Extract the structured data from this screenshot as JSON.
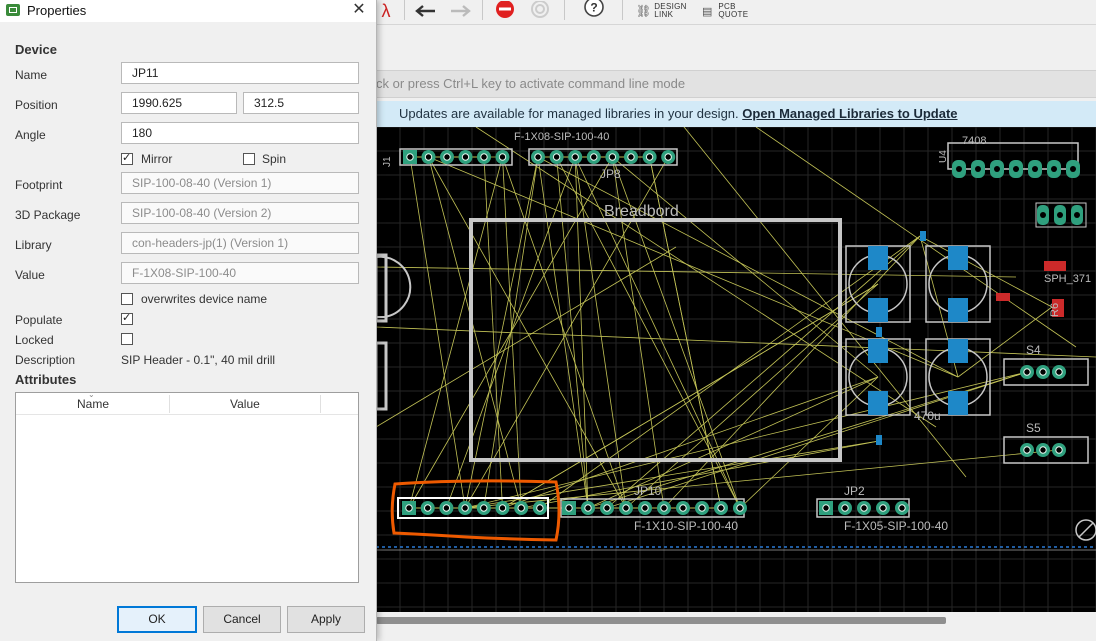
{
  "dialog": {
    "title": "Properties",
    "section_device": "Device",
    "name_label": "Name",
    "name_value": "JP11",
    "position_label": "Position",
    "position_x": "1990.625",
    "position_y": "312.5",
    "angle_label": "Angle",
    "angle_value": "180",
    "mirror_label": "Mirror",
    "mirror_checked": true,
    "spin_label": "Spin",
    "spin_checked": false,
    "footprint_label": "Footprint",
    "footprint_value": "SIP-100-08-40 (Version 1)",
    "package3d_label": "3D Package",
    "package3d_value": "SIP-100-08-40 (Version 2)",
    "library_label": "Library",
    "library_value": "con-headers-jp(1) (Version 1)",
    "value_label": "Value",
    "value_value": "F-1X08-SIP-100-40",
    "overwrites_label": "overwrites device name",
    "overwrites_checked": false,
    "populate_label": "Populate",
    "populate_checked": true,
    "locked_label": "Locked",
    "locked_checked": false,
    "description_label": "Description",
    "description_value": "SIP Header - 0.1\", 40 mil drill",
    "section_attributes": "Attributes",
    "attr_col_name": "Name",
    "attr_col_value": "Value",
    "ok_label": "OK",
    "cancel_label": "Cancel",
    "apply_label": "Apply"
  },
  "toolbar": {
    "design_link_label_1": "DESIGN",
    "design_link_label_2": "LINK",
    "pcb_quote_label_1": "PCB",
    "pcb_quote_label_2": "QUOTE",
    "icons": [
      "function-icon",
      "undo-icon",
      "redo-icon",
      "stop-icon",
      "disabled-icon",
      "help-icon",
      "design-link-icon",
      "pcb-quote-icon"
    ]
  },
  "command_line": {
    "placeholder": "ck or press Ctrl+L key to activate command line mode"
  },
  "banner": {
    "text": "Updates are available for managed libraries in your design.",
    "link": "Open Managed Libraries to Update",
    "bg_color": "#d3eaf7"
  },
  "board": {
    "breadboard_label": "Breadbord",
    "labels": {
      "j1": "J1",
      "f1x08_top": "F-1X08-SIP-100-40",
      "jp8": "JP8",
      "u4": "U4",
      "n7408": "7408",
      "jp10": "JP10",
      "f1x10": "F-1X10-SIP-100-40",
      "jp2": "JP2",
      "f1x05": "F-1X05-SIP-100-40",
      "s4": "S4",
      "s5": "S5",
      "c470": "470u",
      "r6": "R6",
      "smd": "SPH_371"
    },
    "colors": {
      "pad": "#2fa07e",
      "trace": "#d8d860",
      "outline": "#c7c7c7",
      "cap": "#1e88c8",
      "smd": "#cc2a2a",
      "highlight": "#ee5a00"
    }
  }
}
